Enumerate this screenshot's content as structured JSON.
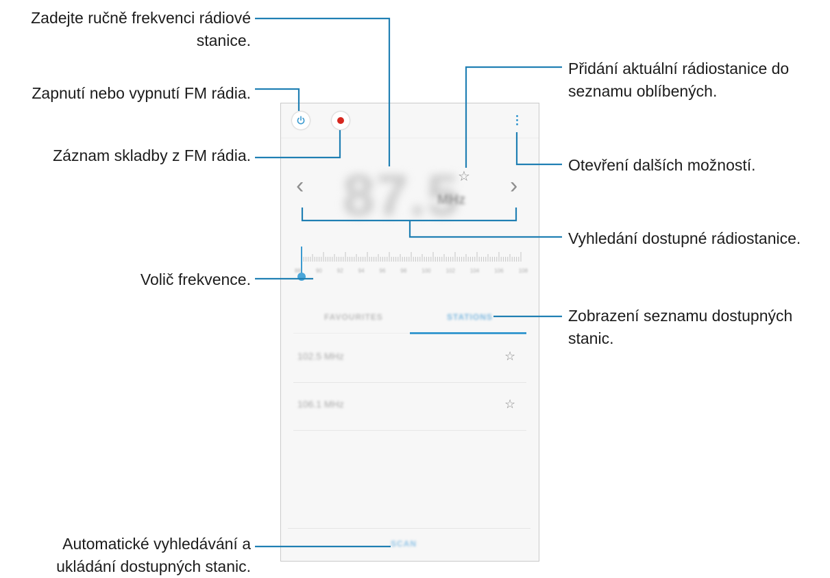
{
  "callouts": {
    "manual_freq": [
      "Zadejte ručně frekvenci rádiové",
      "stanice."
    ],
    "power": "Zapnutí nebo vypnutí FM rádia.",
    "record": "Záznam skladby z FM rádia.",
    "favorites_add": [
      "Přidání aktuální rádiostanice do",
      "seznamu oblíbených."
    ],
    "more_options": "Otevření dalších možností.",
    "search": "Vyhledání dostupné rádiostanice.",
    "tuner": "Volič frekvence.",
    "station_list": [
      "Zobrazení seznamu dostupných",
      "stanic."
    ],
    "auto_scan": [
      "Automatické vyhledávání a",
      "ukládání dostupných stanic."
    ]
  },
  "app": {
    "frequency": "87.5",
    "unit": "MHz",
    "tick_labels": [
      "88",
      "90",
      "92",
      "94",
      "96",
      "98",
      "100",
      "102",
      "104",
      "106",
      "108"
    ],
    "tuner_position_mhz": 88.0,
    "tabs": [
      {
        "label": "FAVOURITES",
        "active": false
      },
      {
        "label": "STATIONS",
        "active": true
      }
    ],
    "stations": [
      {
        "label": "102.5 MHz"
      },
      {
        "label": "106.1 MHz"
      }
    ],
    "scan_label": "SCAN",
    "star_glyph": "☆",
    "prev_glyph": "‹",
    "next_glyph": "›"
  },
  "colors": {
    "accent": "#3a9ad0",
    "record": "#d6271f",
    "callout_line": "#1f7fb3"
  },
  "icons": {
    "power": "power-icon",
    "record": "record-icon",
    "more": "more-vertical-icon",
    "favorite": "star-outline-icon",
    "previous": "chevron-left-icon",
    "next": "chevron-right-icon"
  }
}
